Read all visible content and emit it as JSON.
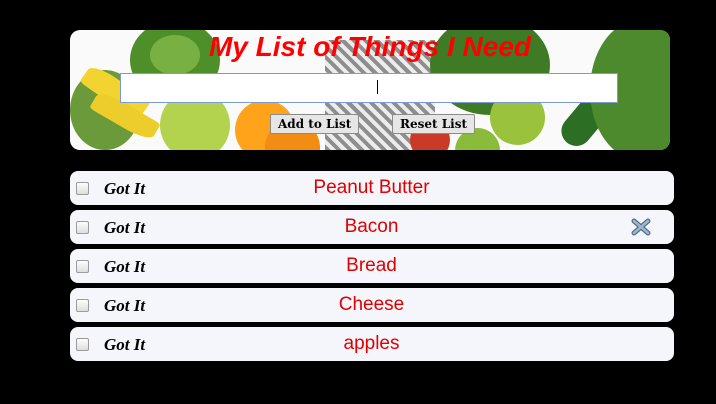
{
  "header": {
    "title": "My List of Things I Need",
    "input_value": "",
    "add_button": "Add to List",
    "reset_button": "Reset List"
  },
  "list": {
    "items": [
      {
        "got_label": "Got It",
        "name": "Peanut Butter",
        "checked": false
      },
      {
        "got_label": "Got It",
        "name": "Bacon",
        "checked": false,
        "delete_icon": "delete-x-icon"
      },
      {
        "got_label": "Got It",
        "name": "Bread",
        "checked": false
      },
      {
        "got_label": "Got It",
        "name": "Cheese",
        "checked": false
      },
      {
        "got_label": "Got It",
        "name": "apples",
        "checked": false
      }
    ]
  },
  "colors": {
    "title": "#ff0000",
    "item_text": "#e00000",
    "row_bg": "#f5f6fb",
    "page_bg": "#000000"
  }
}
